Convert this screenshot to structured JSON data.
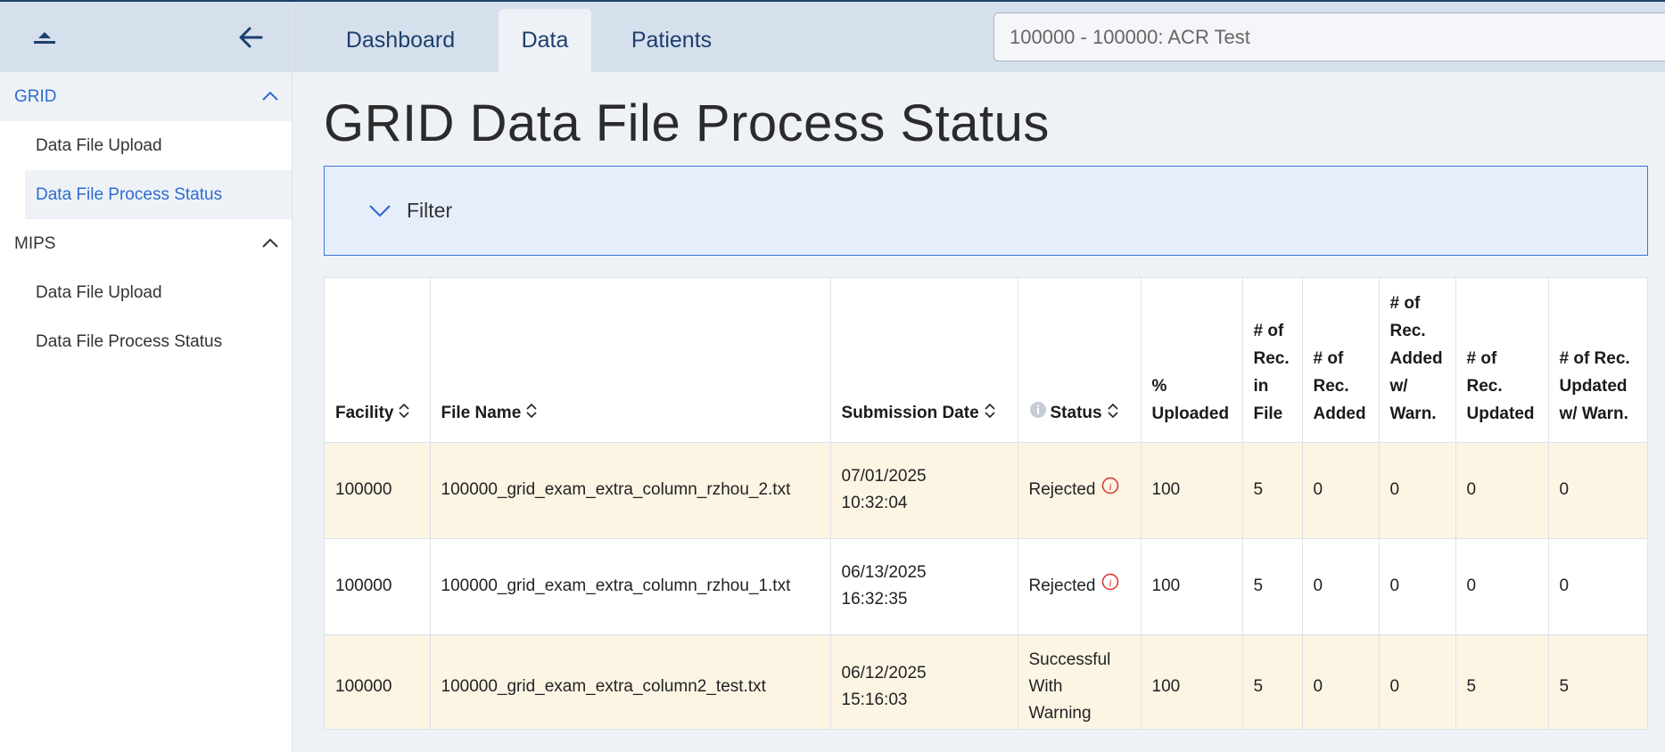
{
  "sidebar": {
    "sections": [
      {
        "label": "GRID",
        "items": [
          "Data File Upload",
          "Data File Process Status"
        ]
      },
      {
        "label": "MIPS",
        "items": [
          "Data File Upload",
          "Data File Process Status"
        ]
      }
    ]
  },
  "nav": {
    "tabs": [
      "Dashboard",
      "Data",
      "Patients"
    ],
    "active_tab": "Data",
    "org_select_value": "100000 - 100000: ACR Test"
  },
  "page": {
    "title": "GRID Data File Process Status",
    "filter_label": "Filter"
  },
  "table": {
    "headers": [
      "Facility",
      "File Name",
      "Submission Date",
      "Status",
      "% Uploaded",
      "# of Rec. in File",
      "# of Rec. Added",
      "# of Rec. Added w/ Warn.",
      "# of Rec. Updated",
      "# of Rec. Updated w/ Warn."
    ],
    "rows": [
      {
        "facility": "100000",
        "file_name": "100000_grid_exam_extra_column_rzhou_2.txt",
        "date": "07/01/2025",
        "time": "10:32:04",
        "status": "Rejected",
        "uploaded": "100",
        "in_file": "5",
        "added": "0",
        "added_warn": "0",
        "updated": "0",
        "updated_warn": "0"
      },
      {
        "facility": "100000",
        "file_name": "100000_grid_exam_extra_column_rzhou_1.txt",
        "date": "06/13/2025",
        "time": "16:32:35",
        "status": "Rejected",
        "uploaded": "100",
        "in_file": "5",
        "added": "0",
        "added_warn": "0",
        "updated": "0",
        "updated_warn": "0"
      },
      {
        "facility": "100000",
        "file_name": "100000_grid_exam_extra_column2_test.txt",
        "date": "06/12/2025",
        "time": "15:16:03",
        "status": "Successful With Warning",
        "uploaded": "100",
        "in_file": "5",
        "added": "0",
        "added_warn": "0",
        "updated": "5",
        "updated_warn": "5"
      }
    ]
  },
  "colors": {
    "accent": "#2f6bd1",
    "nav_bg": "#d6e0ec",
    "row_highlight": "#fdf5e4",
    "rejected_icon": "#d9302c",
    "filter_bg": "#e7eefb"
  }
}
